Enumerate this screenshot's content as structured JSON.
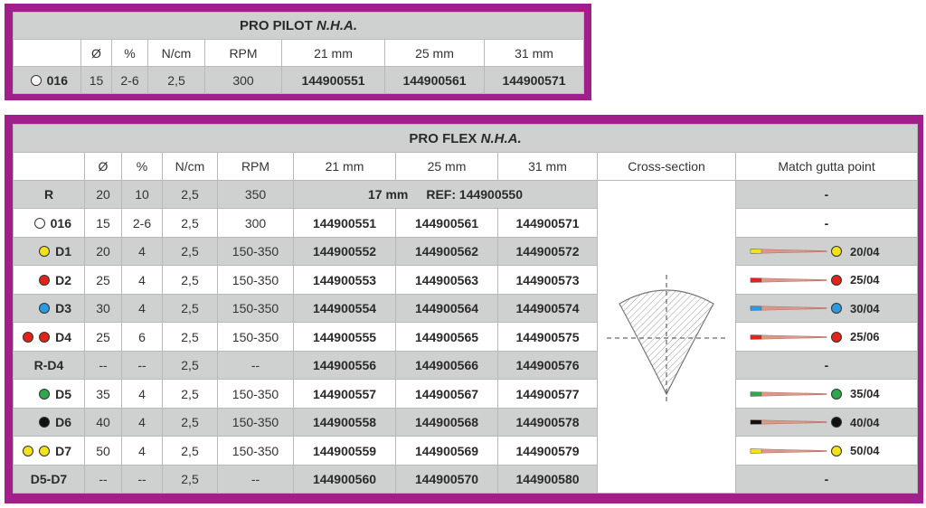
{
  "pilot": {
    "title_main": "PRO PILOT",
    "title_em": "N.H.A.",
    "headers": [
      "",
      "Ø",
      "%",
      "N/cm",
      "RPM",
      "21 mm",
      "25 mm",
      "31 mm"
    ],
    "row": {
      "label": "016",
      "dot": "#ffffff",
      "diam": "15",
      "taper": "2-6",
      "torque": "2,5",
      "rpm": "300",
      "refs": [
        "144900551",
        "144900561",
        "144900571"
      ]
    }
  },
  "flex": {
    "title_main": "PRO FLEX",
    "title_em": "N.H.A.",
    "headers": [
      "",
      "Ø",
      "%",
      "N/cm",
      "RPM",
      "21 mm",
      "25 mm",
      "31 mm",
      "Cross-section",
      "Match gutta point"
    ],
    "rows": [
      {
        "label": "R",
        "dots": [],
        "diam": "20",
        "taper": "10",
        "torque": "2,5",
        "rpm": "350",
        "span_len": "17 mm",
        "span_ref": "REF: 144900550",
        "refs": [],
        "match": "-",
        "gp_color": null,
        "bg": "g"
      },
      {
        "label": "016",
        "dots": [
          "#ffffff"
        ],
        "diam": "15",
        "taper": "2-6",
        "torque": "2,5",
        "rpm": "300",
        "refs": [
          "144900551",
          "144900561",
          "144900571"
        ],
        "match": "-",
        "gp_color": null,
        "bg": "w"
      },
      {
        "label": "D1",
        "dots": [
          "#f2e21a"
        ],
        "diam": "20",
        "taper": "4",
        "torque": "2,5",
        "rpm": "150-350",
        "refs": [
          "144900552",
          "144900562",
          "144900572"
        ],
        "match": "20/04",
        "gp_color": "#f2e21a",
        "bg": "g"
      },
      {
        "label": "D2",
        "dots": [
          "#e2231a"
        ],
        "diam": "25",
        "taper": "4",
        "torque": "2,5",
        "rpm": "150-350",
        "refs": [
          "144900553",
          "144900563",
          "144900573"
        ],
        "match": "25/04",
        "gp_color": "#e2231a",
        "bg": "w"
      },
      {
        "label": "D3",
        "dots": [
          "#2b9be0"
        ],
        "diam": "30",
        "taper": "4",
        "torque": "2,5",
        "rpm": "150-350",
        "refs": [
          "144900554",
          "144900564",
          "144900574"
        ],
        "match": "30/04",
        "gp_color": "#2b9be0",
        "bg": "g"
      },
      {
        "label": "D4",
        "dots": [
          "#e2231a",
          "#e2231a"
        ],
        "diam": "25",
        "taper": "6",
        "torque": "2,5",
        "rpm": "150-350",
        "refs": [
          "144900555",
          "144900565",
          "144900575"
        ],
        "match": "25/06",
        "gp_color": "#e2231a",
        "bg": "w"
      },
      {
        "label": "R-D4",
        "dots": [],
        "diam": "--",
        "taper": "--",
        "torque": "2,5",
        "rpm": "--",
        "refs": [
          "144900556",
          "144900566",
          "144900576"
        ],
        "match": "-",
        "gp_color": null,
        "bg": "g"
      },
      {
        "label": "D5",
        "dots": [
          "#2ea84a"
        ],
        "diam": "35",
        "taper": "4",
        "torque": "2,5",
        "rpm": "150-350",
        "refs": [
          "144900557",
          "144900567",
          "144900577"
        ],
        "match": "35/04",
        "gp_color": "#2ea84a",
        "bg": "w"
      },
      {
        "label": "D6",
        "dots": [
          "#111111"
        ],
        "diam": "40",
        "taper": "4",
        "torque": "2,5",
        "rpm": "150-350",
        "refs": [
          "144900558",
          "144900568",
          "144900578"
        ],
        "match": "40/04",
        "gp_color": "#111111",
        "bg": "g"
      },
      {
        "label": "D7",
        "dots": [
          "#f2e21a",
          "#f2e21a"
        ],
        "diam": "50",
        "taper": "4",
        "torque": "2,5",
        "rpm": "150-350",
        "refs": [
          "144900559",
          "144900569",
          "144900579"
        ],
        "match": "50/04",
        "gp_color": "#f2e21a",
        "bg": "w"
      },
      {
        "label": "D5-D7",
        "dots": [],
        "diam": "--",
        "taper": "--",
        "torque": "2,5",
        "rpm": "--",
        "refs": [
          "144900560",
          "144900570",
          "144900580"
        ],
        "match": "-",
        "gp_color": null,
        "bg": "g"
      }
    ]
  }
}
